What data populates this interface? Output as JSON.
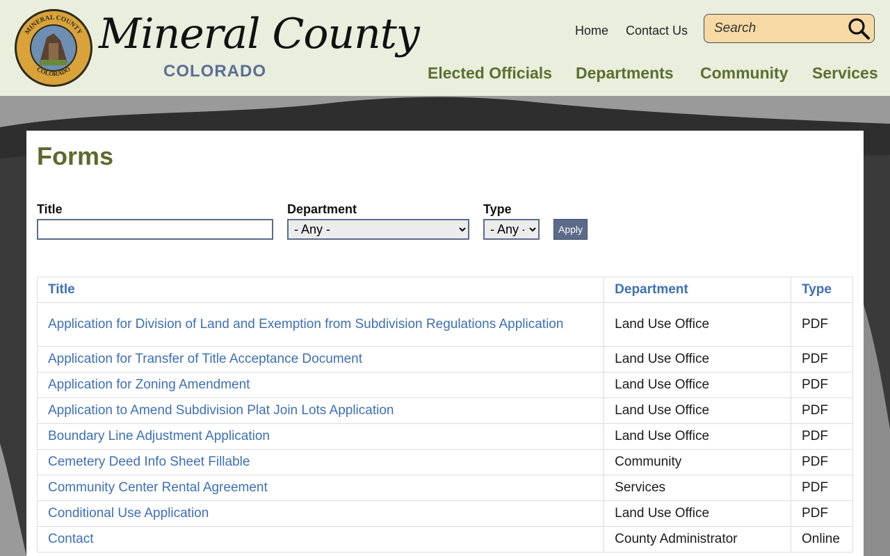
{
  "site": {
    "seal_text_top": "MINERAL COUNTY",
    "seal_text_bottom": "COLORADO",
    "brand_script": "Mineral County",
    "brand_state": "COLORADO"
  },
  "utility_nav": {
    "home": "Home",
    "contact": "Contact Us"
  },
  "search": {
    "placeholder": "Search"
  },
  "main_nav": [
    "Elected Officials",
    "Departments",
    "Community",
    "Services"
  ],
  "page_title": "Forms",
  "filters": {
    "title_label": "Title",
    "department_label": "Department",
    "department_selected": "- Any -",
    "type_label": "Type",
    "type_selected": "- Any -",
    "apply_label": "Apply"
  },
  "table": {
    "headers": [
      "Title",
      "Department",
      "Type"
    ],
    "rows": [
      {
        "title": "Application for Division of Land and Exemption from Subdivision Regulations Application",
        "department": "Land Use Office",
        "type": "PDF"
      },
      {
        "title": "Application for Transfer of Title Acceptance Document",
        "department": "Land Use Office",
        "type": "PDF"
      },
      {
        "title": "Application for Zoning Amendment",
        "department": "Land Use Office",
        "type": "PDF"
      },
      {
        "title": "Application to Amend Subdivision Plat Join Lots Application",
        "department": "Land Use Office",
        "type": "PDF"
      },
      {
        "title": "Boundary Line Adjustment Application",
        "department": "Land Use Office",
        "type": "PDF"
      },
      {
        "title": "Cemetery Deed Info Sheet Fillable",
        "department": "Community",
        "type": "PDF"
      },
      {
        "title": "Community Center Rental Agreement",
        "department": "Services",
        "type": "PDF"
      },
      {
        "title": "Conditional Use Application",
        "department": "Land Use Office",
        "type": "PDF"
      },
      {
        "title": "Contact",
        "department": "County Administrator",
        "type": "Online"
      }
    ]
  },
  "colors": {
    "header_bg": "#e9eedd",
    "nav_green": "#5c6e2e",
    "title_green": "#5a6b2c",
    "link_blue": "#3d6fb6",
    "search_bg": "#f6d9a4",
    "apply_bg": "#5b6b8a"
  }
}
